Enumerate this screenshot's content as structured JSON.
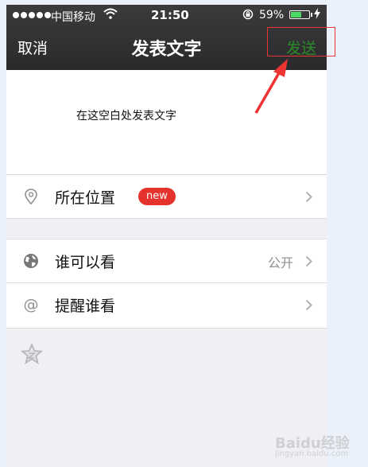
{
  "status_bar": {
    "carrier": "中国移动",
    "time": "21:50",
    "battery_percent": "59%",
    "battery_level": 0.59,
    "icons": [
      "signal-dots-icon",
      "wifi-icon",
      "rotation-lock-icon",
      "battery-icon",
      "charging-bolt-icon"
    ]
  },
  "nav": {
    "cancel_label": "取消",
    "title": "发表文字",
    "send_label": "发送"
  },
  "compose": {
    "hint_text": "在这空白处发表文字"
  },
  "rows": {
    "location": {
      "label": "所在位置",
      "badge": "new",
      "icon": "location-pin-icon"
    },
    "visibility": {
      "label": "谁可以看",
      "value": "公开",
      "icon": "globe-icon"
    },
    "remind": {
      "label": "提醒谁看",
      "icon": "at-icon"
    }
  },
  "extra": {
    "icon": "star-icon"
  },
  "watermark": {
    "text": "Baidu经验",
    "sub": "jingyan.baidu.com"
  },
  "colors": {
    "topbar": "#2f2f31",
    "send_text": "#2a8c2a",
    "highlight_box": "#ee3333",
    "badge": "#e5322d",
    "battery_fill": "#4cd964"
  }
}
